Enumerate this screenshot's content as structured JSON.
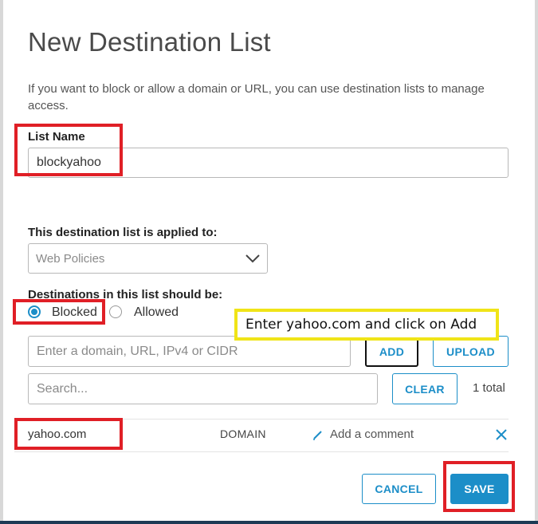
{
  "dialog": {
    "title": "New Destination List",
    "intro": "If you want to block or allow a domain or URL, you can use destination lists to manage access."
  },
  "list_name": {
    "label": "List Name",
    "value": "blockyahoo"
  },
  "applied_to": {
    "label": "This destination list is applied to:",
    "selected": "Web Policies"
  },
  "destinations": {
    "label": "Destinations in this list should be:",
    "options": [
      {
        "label": "Blocked",
        "selected": true
      },
      {
        "label": "Allowed",
        "selected": false
      }
    ]
  },
  "add_row": {
    "placeholder": "Enter a domain, URL, IPv4 or CIDR",
    "add_label": "ADD",
    "upload_label": "UPLOAD"
  },
  "search_row": {
    "placeholder": "Search...",
    "clear_label": "CLEAR",
    "total": "1 total"
  },
  "entries": [
    {
      "destination": "yahoo.com",
      "type": "DOMAIN",
      "comment": "Add a comment"
    }
  ],
  "footer": {
    "cancel_label": "CANCEL",
    "save_label": "SAVE"
  },
  "annotation": {
    "callout": "Enter yahoo.com and click on Add",
    "callout_color": "#f0e418",
    "highlight_color": "#e01f26"
  },
  "colors": {
    "accent": "#1c8ec8"
  }
}
